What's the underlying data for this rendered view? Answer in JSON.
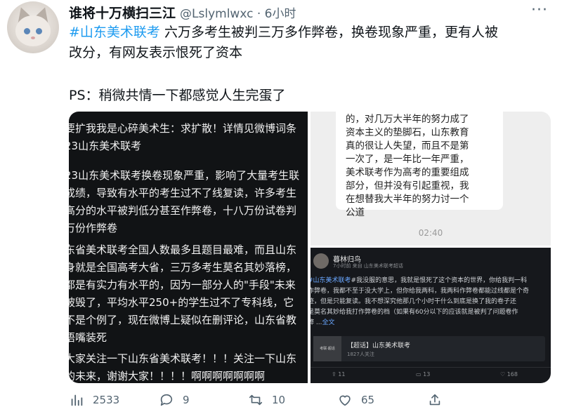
{
  "tweet": {
    "author_name": "谁将十万横扫三江",
    "handle_time": "@Lslymlwxc · 6小时",
    "hashtag": "#山东美术联考",
    "text_line1": " 六万多考生被判三万多作弊卷，换卷现象严重，更有人被",
    "text_line2": "改分，有网友表示恨死了资本",
    "ps": "PS：稍微共情一下都感觉人生完蛋了"
  },
  "media": {
    "left_panel_lines": [
      "要扩我我是心碎美术生：求扩散！详情见微博词条",
      "23山东美术联考",
      "",
      "23山东美术联考换卷现象严重，影响了大量考生联",
      "成绩，导致有水平的考生过不了线复读，许多考生",
      "高分的水平被判低分甚至作弊卷，十八万份试卷判",
      "万份作弊卷",
      "",
      "东省美术联考全国人数最多且题目最难，而且山东",
      "身就是全国高考大省，三万多考生莫名其妙落榜，",
      "都是有实力有水平的，因为一部分人的\"手段\"未来",
      "被毁了，平均水平250+的学生过不了专科线，它",
      "不是个例了，现在微博上疑似在删评论，山东省教",
      "捂嘴装死",
      "",
      "大家关注一下山东省美术联考！！！关注一下山东",
      "的未来，谢谢大家！！！！啊啊啊啊啊啊啊"
    ],
    "chat_bubble_lines": [
      "的，对几万大半年的努力成了",
      "资本主义的垫脚石，山东教育",
      "真的很让人失望，而且不是第",
      "一次了，是一年比一年严重，",
      "美术联考作为高考的重要组成",
      "部分，但并没有引起重视，我",
      "在想替我大半年的努力讨一个",
      "公道"
    ],
    "chat_time": "02:40",
    "post": {
      "username": "暮林归鸟",
      "meta": "7小时前  来自 山东美术联考超话",
      "tag": "#山东美术联考",
      "line1_rest": "#我没服的意思，我就是恨死了这个资本的世界，你给我判一科",
      "line2": "作弊卷，我都不至于没大学上，但你给我两科，我两科作弊卷都能过线都是个奇",
      "line3": "迹，但是只能复读。我不想深究他那几个小时干什么到底是换了我的卷子还",
      "line4": "是莫名其妙给我打作弊卷的档（如果有60分以下的应该就是被判了问题卷作",
      "line5_prefix": "弊 ...",
      "full_text": "全文",
      "card_thumb": "考联·超话",
      "card_title": "【超话】山东美术联考",
      "card_sub": "1827人关注",
      "shares": "11",
      "comments": "13",
      "likes": "168"
    }
  },
  "actions": {
    "views": "2533",
    "replies": "9",
    "retweets": "10",
    "likes": "65"
  },
  "colors": {
    "accent": "#1d9bf0",
    "muted": "#536471"
  }
}
